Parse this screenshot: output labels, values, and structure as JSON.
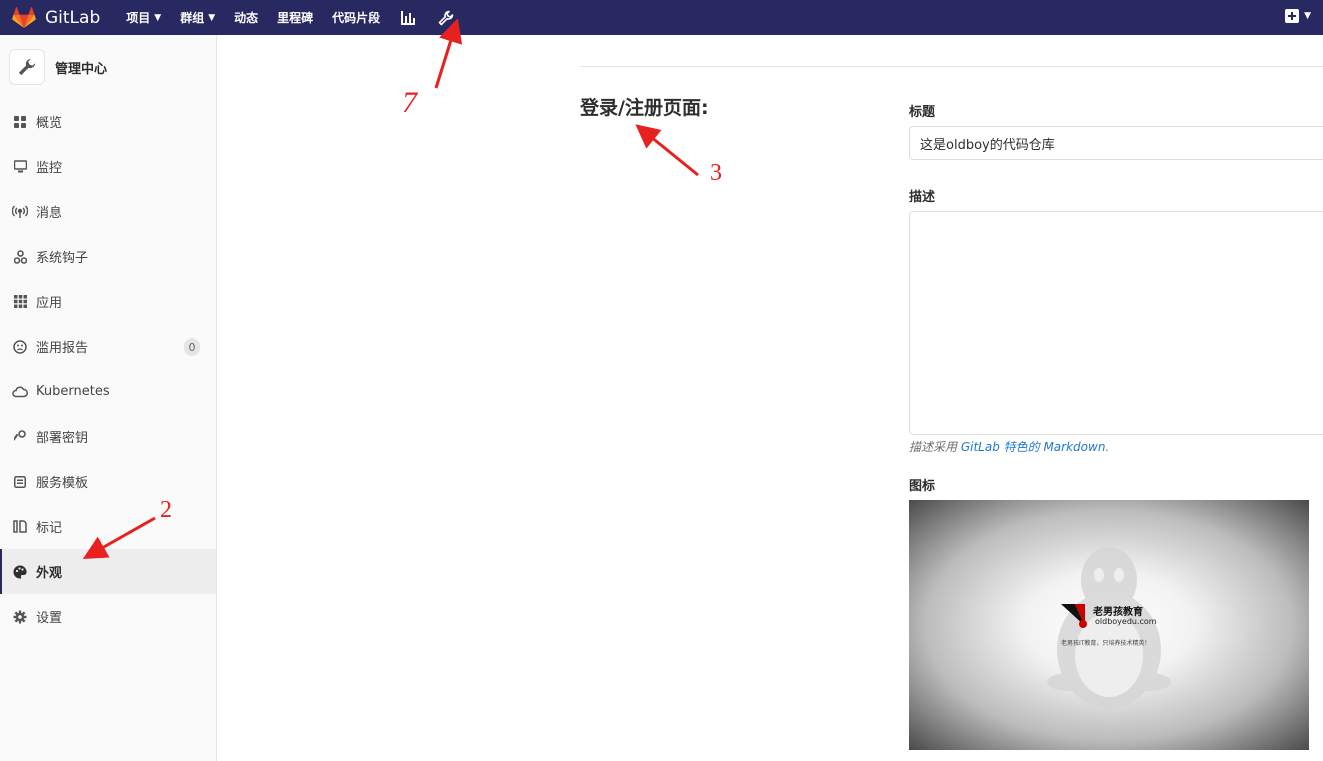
{
  "topnav": {
    "brand": "GitLab",
    "items": [
      {
        "label": "项目",
        "caret": true
      },
      {
        "label": "群组",
        "caret": true
      },
      {
        "label": "动态",
        "caret": false
      },
      {
        "label": "里程碑",
        "caret": false
      },
      {
        "label": "代码片段",
        "caret": false
      }
    ],
    "icons": [
      "chart-bar-icon",
      "wrench-icon"
    ],
    "right_icon": "plus-square-icon"
  },
  "sidebar": {
    "title": "管理中心",
    "items": [
      {
        "label": "概览",
        "icon": "grid-icon"
      },
      {
        "label": "监控",
        "icon": "monitor-icon"
      },
      {
        "label": "消息",
        "icon": "broadcast-icon"
      },
      {
        "label": "系统钩子",
        "icon": "hook-icon"
      },
      {
        "label": "应用",
        "icon": "apps-icon"
      },
      {
        "label": "滥用报告",
        "icon": "face-icon",
        "badge": "0"
      },
      {
        "label": "Kubernetes",
        "icon": "cloud-icon"
      },
      {
        "label": "部署密钥",
        "icon": "key-icon"
      },
      {
        "label": "服务模板",
        "icon": "template-icon"
      },
      {
        "label": "标记",
        "icon": "label-icon"
      },
      {
        "label": "外观",
        "icon": "palette-icon",
        "active": true
      },
      {
        "label": "设置",
        "icon": "gear-icon"
      }
    ]
  },
  "main": {
    "section_title": "登录/注册页面:",
    "title_label": "标题",
    "title_value": "这是oldboy的代码仓库",
    "description_label": "描述",
    "description_value": "",
    "help_prefix": "描述采用 ",
    "help_link": "GitLab 特色的 Markdown",
    "help_suffix": ".",
    "logo_label": "图标",
    "logo_image": {
      "brand": "老男孩教育",
      "url": "oldboyedu.com",
      "tagline": "老男孩IT教育，只培养技术精英！"
    }
  },
  "annotations": [
    "7",
    "3",
    "2"
  ],
  "colors": {
    "nav": "#292961",
    "annotation": "#e8201f",
    "link": "#1f78d1"
  }
}
